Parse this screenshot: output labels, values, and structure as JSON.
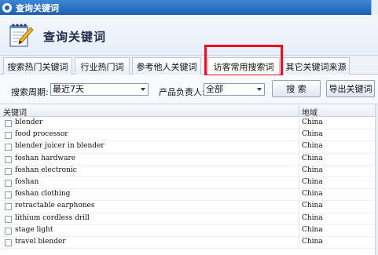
{
  "window": {
    "title": "查询关键词"
  },
  "header": {
    "heading": "查询关键词"
  },
  "tabs": [
    {
      "label": "搜索热门关键词"
    },
    {
      "label": "行业热门词"
    },
    {
      "label": "参考他人关键词"
    },
    {
      "label": "访客常用搜索词",
      "active": true
    },
    {
      "label": "其它关键词来源"
    }
  ],
  "filters": {
    "period_label": "搜索周期:",
    "period_value": "最近7天",
    "owner_label": "产品负责人:",
    "owner_value": "全部",
    "search_button": "搜 索",
    "export_button": "导出关键词"
  },
  "table": {
    "columns": [
      "关键词",
      "地域"
    ],
    "rows": [
      {
        "keyword": "blender",
        "region": "China"
      },
      {
        "keyword": "food processor",
        "region": "China"
      },
      {
        "keyword": "blender juicer in blender",
        "region": "China"
      },
      {
        "keyword": "foshan hardware",
        "region": "China"
      },
      {
        "keyword": "foshan electronic",
        "region": "China"
      },
      {
        "keyword": "foshan",
        "region": "China"
      },
      {
        "keyword": "foshan clothing",
        "region": "China"
      },
      {
        "keyword": "retractable earphones",
        "region": "China"
      },
      {
        "keyword": "lithium cordless drill",
        "region": "China"
      },
      {
        "keyword": "stage light",
        "region": "China"
      },
      {
        "keyword": "travel blender",
        "region": "China"
      }
    ]
  },
  "colors": {
    "titlebar": "#1d5fb3",
    "highlight": "#e8101a"
  }
}
